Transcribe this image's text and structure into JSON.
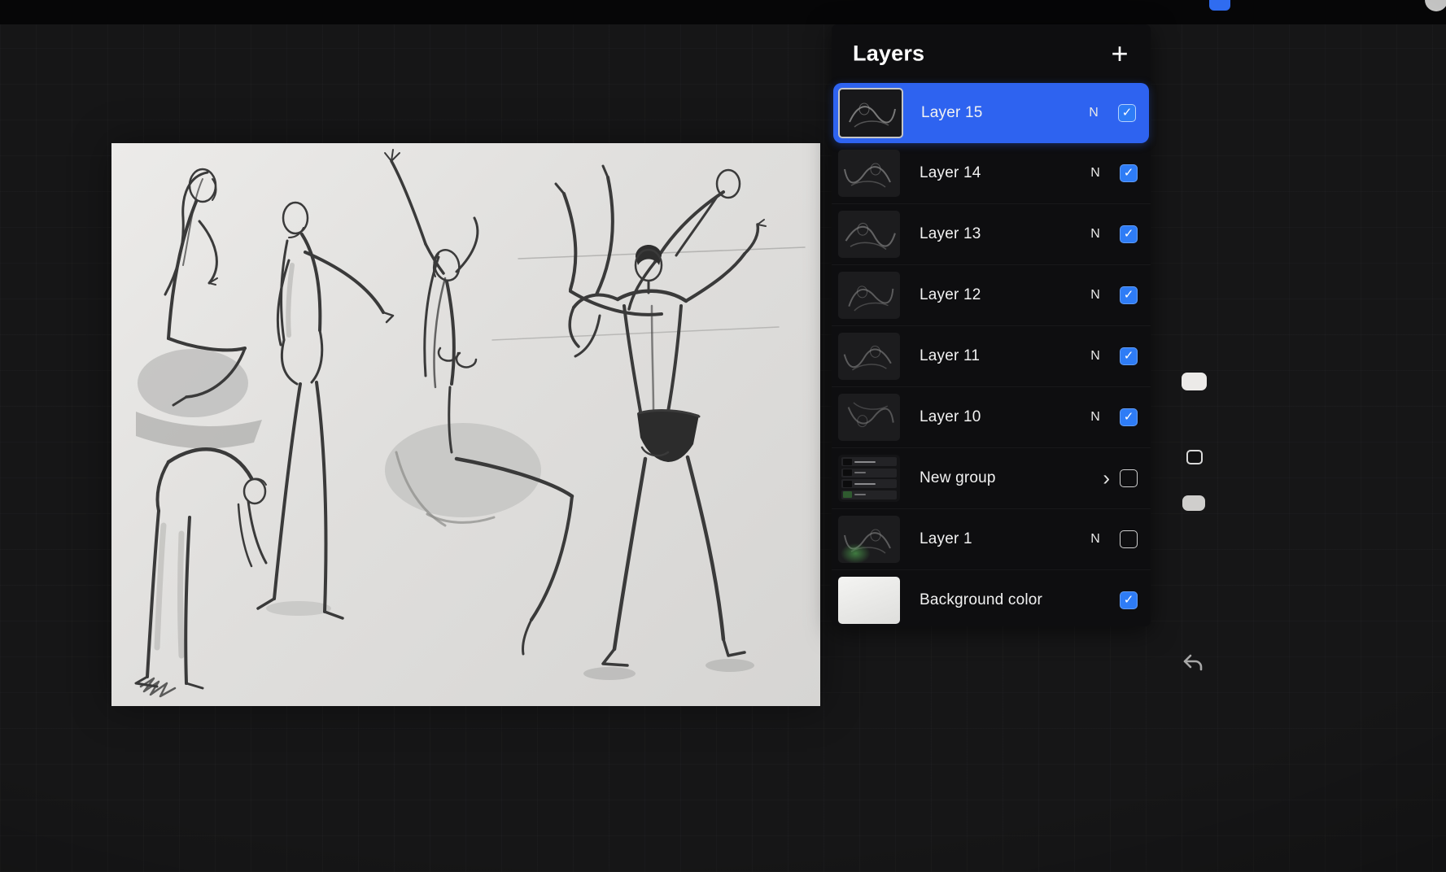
{
  "layers_panel": {
    "title": "Layers",
    "add_button_label": "+",
    "accent_color": "#2E63F0",
    "checkbox_color": "#2E7CF6",
    "check_glyph": "✓",
    "group_chevron_glyph": "›",
    "rows": [
      {
        "name": "Layer 15",
        "blend_mode": "N",
        "visible": true,
        "selected": true,
        "kind": "layer"
      },
      {
        "name": "Layer 14",
        "blend_mode": "N",
        "visible": true,
        "selected": false,
        "kind": "layer"
      },
      {
        "name": "Layer 13",
        "blend_mode": "N",
        "visible": true,
        "selected": false,
        "kind": "layer"
      },
      {
        "name": "Layer 12",
        "blend_mode": "N",
        "visible": true,
        "selected": false,
        "kind": "layer"
      },
      {
        "name": "Layer 11",
        "blend_mode": "N",
        "visible": true,
        "selected": false,
        "kind": "layer"
      },
      {
        "name": "Layer 10",
        "blend_mode": "N",
        "visible": true,
        "selected": false,
        "kind": "layer"
      },
      {
        "name": "New group",
        "blend_mode": "",
        "visible": false,
        "selected": false,
        "kind": "group"
      },
      {
        "name": "Layer 1",
        "blend_mode": "N",
        "visible": false,
        "selected": false,
        "kind": "layer"
      },
      {
        "name": "Background color",
        "blend_mode": "",
        "visible": true,
        "selected": false,
        "kind": "background"
      }
    ]
  },
  "canvas": {
    "paper_color": "#E2E2E0",
    "content": "figure gesture drawing sketches, charcoal on light paper"
  },
  "side_controls": {
    "undo": "undo",
    "modify": "modify",
    "brush_size_slider": "brush size",
    "opacity_slider": "opacity"
  }
}
